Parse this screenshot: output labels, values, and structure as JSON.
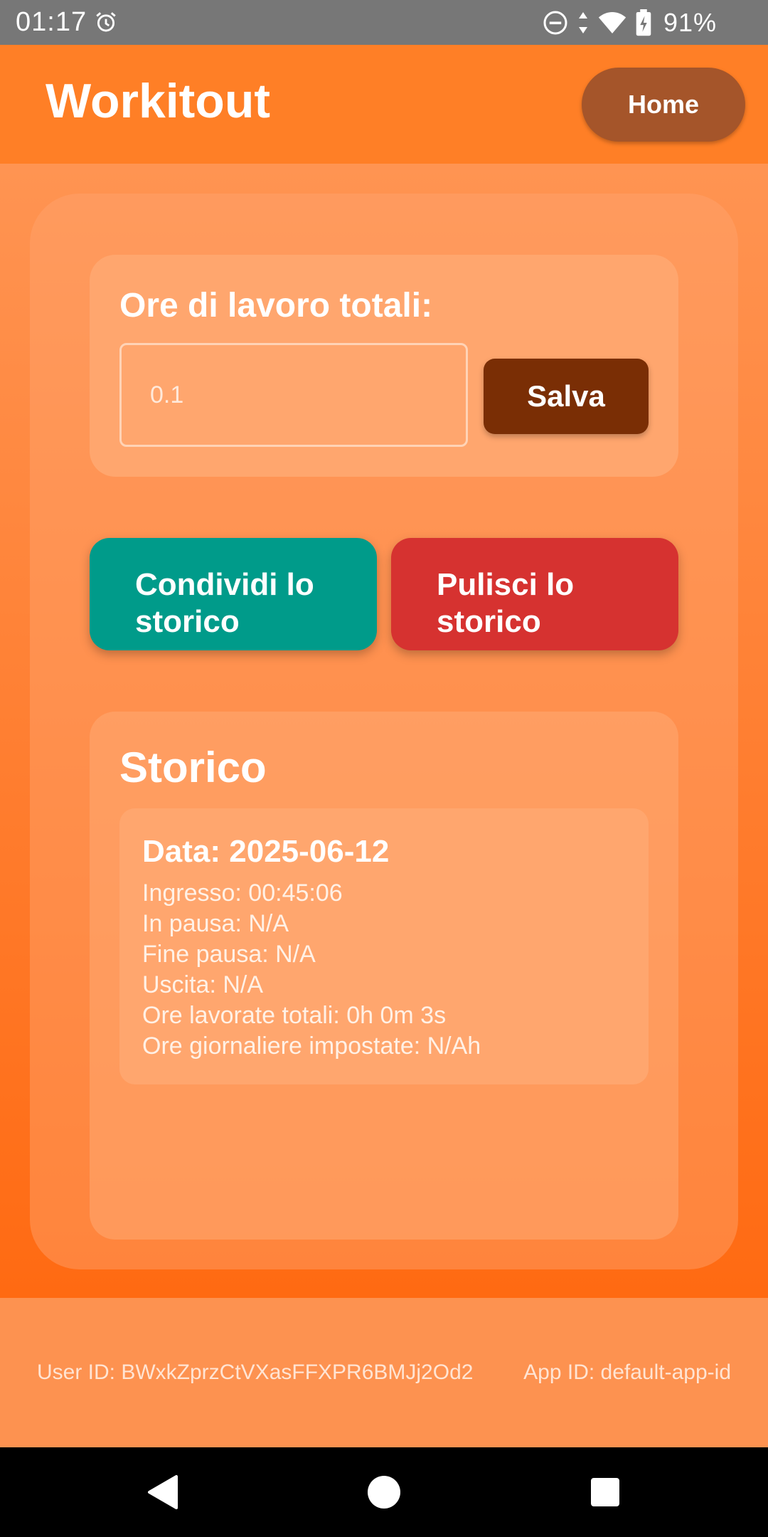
{
  "status_bar": {
    "time": "01:17",
    "battery": "91%",
    "icons": [
      "alarm-icon",
      "do-not-disturb-icon",
      "data-arrows-icon",
      "wifi-icon",
      "battery-charging-icon"
    ]
  },
  "header": {
    "title": "Workitout",
    "home_label": "Home"
  },
  "hours": {
    "label": "Ore di lavoro totali:",
    "input_value": "0.1",
    "save_label": "Salva"
  },
  "actions": {
    "share_label": "Condividi lo storico",
    "clear_label": "Pulisci lo storico"
  },
  "history": {
    "title": "Storico",
    "entries": [
      {
        "date": "Data: 2025-06-12",
        "ingresso": "Ingresso: 00:45:06",
        "in_pausa": "In pausa: N/A",
        "fine_pausa": "Fine pausa: N/A",
        "uscita": "Uscita: N/A",
        "ore_totali": "Ore lavorate totali: 0h 0m 3s",
        "ore_impostate": "Ore giornaliere impostate: N/Ah"
      }
    ]
  },
  "footer": {
    "user_id": "User ID: BWxkZprzCtVXasFFXPR6BMJj2Od2",
    "app_id": "App ID: default-app-id"
  },
  "colors": {
    "header": "#ff7f26",
    "home_button": "#a5552a",
    "save_button": "#7a2e05",
    "share_button": "#009b8a",
    "clear_button": "#d63230"
  }
}
